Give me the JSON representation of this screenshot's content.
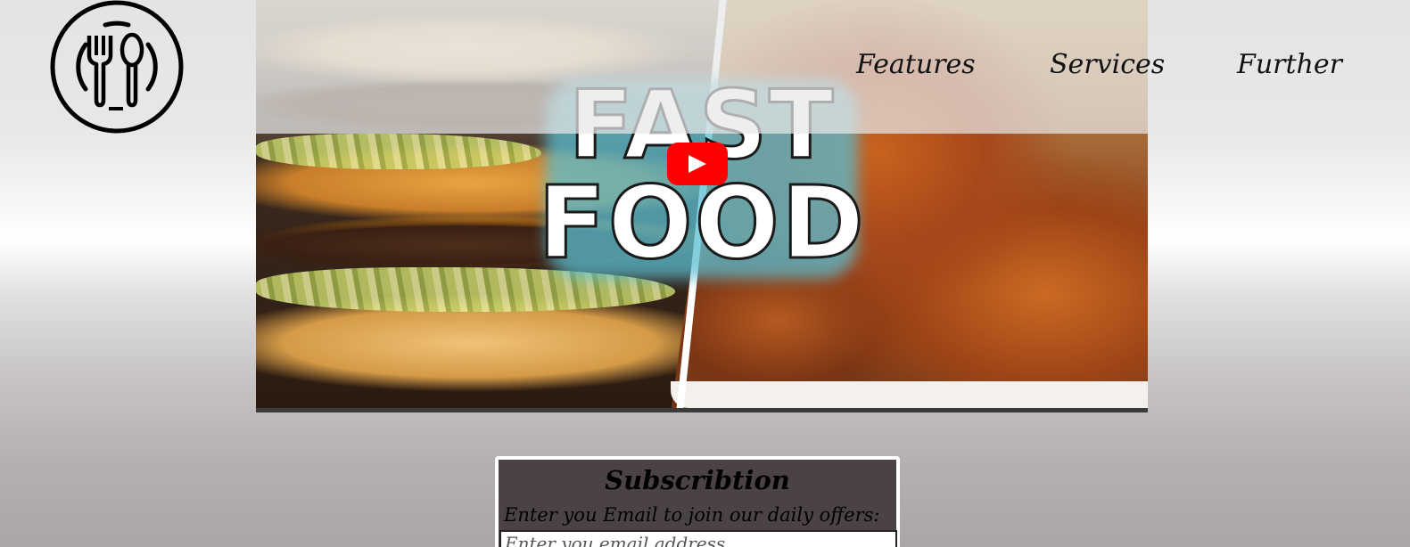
{
  "header": {
    "logo_icon": "fork-spoon-plate-icon",
    "nav": {
      "features": "Features",
      "services": "Services",
      "further": "Further"
    }
  },
  "video": {
    "thumbnail_title_line1": "FAST",
    "thumbnail_title_line2": "FOOD",
    "play_icon": "youtube-play-icon"
  },
  "subscription": {
    "heading": "Subscribtion",
    "description": "Enter you Email to join our daily offers:",
    "email_placeholder": "Enter you email address"
  },
  "colors": {
    "play_button": "#ff0000",
    "subscription_bg": "#4a4243",
    "header_overlay": "#e8e8e8"
  }
}
